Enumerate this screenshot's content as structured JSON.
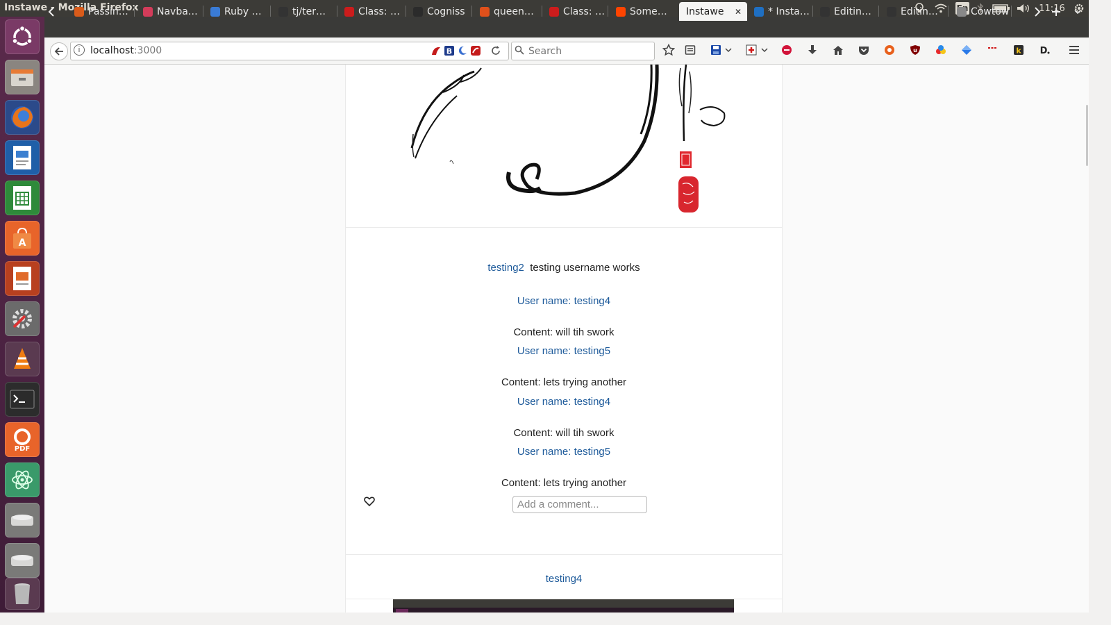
{
  "window": {
    "title": "Instawe - Mozilla Firefox",
    "time": "11:16",
    "keyboard": "En"
  },
  "tabs": [
    {
      "label": "Passin…",
      "color": "#d95b1a"
    },
    {
      "label": "Navba…",
      "color": "#d33c5a"
    },
    {
      "label": "Ruby …",
      "color": "#3a7bd5"
    },
    {
      "label": "tj/ter…",
      "color": "#333333"
    },
    {
      "label": "Class: …",
      "color": "#cc1c1c"
    },
    {
      "label": "Cogniss",
      "color": "#2b2b2b"
    },
    {
      "label": "queen…",
      "color": "#e0501b"
    },
    {
      "label": "Class: …",
      "color": "#cc1c1c"
    },
    {
      "label": "Some…",
      "color": "#ff4400"
    },
    {
      "label": "Instawe",
      "color": "#ffffff",
      "active": true
    },
    {
      "label": "* Insta…",
      "color": "#1f6fc2"
    },
    {
      "label": "Editin…",
      "color": "#333333"
    },
    {
      "label": "Editin…",
      "color": "#333333"
    },
    {
      "label": "Cowtown",
      "color": "#888888"
    }
  ],
  "nav": {
    "url_host": "localhost",
    "url_port": ":3000",
    "search_placeholder": "Search"
  },
  "post1": {
    "author": "testing2",
    "caption": "testing username works",
    "comments": [
      {
        "user": "User name: testing4",
        "content": "Content: will tih swork"
      },
      {
        "user": "User name: testing5",
        "content": "Content: lets trying another"
      },
      {
        "user": "User name: testing4",
        "content": "Content: will tih swork"
      },
      {
        "user": "User name: testing5",
        "content": "Content: lets trying another"
      }
    ],
    "comment_placeholder": "Add a comment..."
  },
  "post2": {
    "author": "testing4"
  },
  "colors": {
    "link": "#1d5a9a",
    "launcher": "#4a2241",
    "panel": "#3c3b37"
  }
}
